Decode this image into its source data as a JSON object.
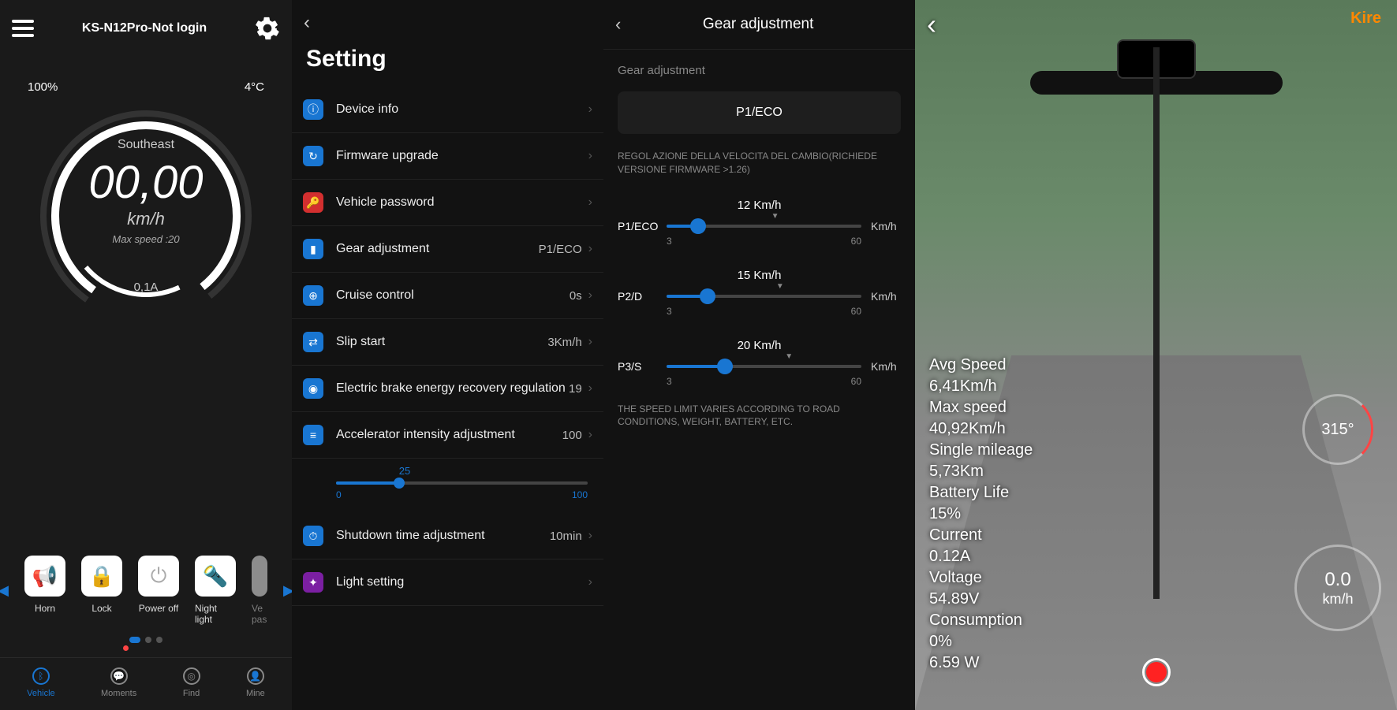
{
  "pane1": {
    "title": "KS-N12Pro-Not login",
    "battery": "100%",
    "temp": "4°C",
    "direction": "Southeast",
    "speed": "00,00",
    "unit": "km/h",
    "maxspeed": "Max speed :20",
    "amps": "0,1A",
    "controls": [
      {
        "label": "Horn",
        "icon": "📢"
      },
      {
        "label": "Lock",
        "icon": "🔒"
      },
      {
        "label": "Power off",
        "icon": "⏻"
      },
      {
        "label": "Night light",
        "icon": "🔦"
      },
      {
        "label": "Ve pas",
        "icon": ""
      }
    ],
    "nav": [
      {
        "label": "Vehicle",
        "active": true
      },
      {
        "label": "Moments",
        "active": false
      },
      {
        "label": "Find",
        "active": false
      },
      {
        "label": "Mine",
        "active": false
      }
    ]
  },
  "pane2": {
    "title": "Setting",
    "items": [
      {
        "label": "Device info",
        "value": "",
        "icon": "ⓘ",
        "color": "blue"
      },
      {
        "label": "Firmware upgrade",
        "value": "",
        "icon": "↻",
        "color": "blue"
      },
      {
        "label": "Vehicle password",
        "value": "",
        "icon": "🔑",
        "color": "red"
      },
      {
        "label": "Gear adjustment",
        "value": "P1/ECO",
        "icon": "▮",
        "color": "blue"
      },
      {
        "label": "Cruise control",
        "value": "0s",
        "icon": "⊕",
        "color": "blue"
      },
      {
        "label": "Slip start",
        "value": "3Km/h",
        "icon": "⇄",
        "color": "blue"
      },
      {
        "label": "Electric brake energy recovery regulation",
        "value": "19",
        "icon": "◉",
        "color": "blue"
      },
      {
        "label": "Accelerator intensity adjustment",
        "value": "100",
        "icon": "≡",
        "color": "blue",
        "slider": {
          "val": "25",
          "min": "0",
          "max": "100",
          "pct": 25
        }
      },
      {
        "label": "Shutdown time adjustment",
        "value": "10min",
        "icon": "⏱",
        "color": "blue"
      },
      {
        "label": "Light setting",
        "value": "",
        "icon": "✦",
        "color": "purple"
      }
    ]
  },
  "pane3": {
    "title": "Gear adjustment",
    "section": "Gear adjustment",
    "mode": "P1/ECO",
    "note1": "REGOL AZIONE DELLA VELOCITA DEL CAMBIO(RICHIEDE VERSIONE FIRMWARE >1.26)",
    "sliders": [
      {
        "label": "P1/ECO",
        "value": "12 Km/h",
        "min": "3",
        "max": "60",
        "unit": "Km/h",
        "pct": 16
      },
      {
        "label": "P2/D",
        "value": "15 Km/h",
        "min": "3",
        "max": "60",
        "unit": "Km/h",
        "pct": 21
      },
      {
        "label": "P3/S",
        "value": "20 Km/h",
        "min": "3",
        "max": "60",
        "unit": "Km/h",
        "pct": 30
      }
    ],
    "note2": "THE SPEED LIMIT VARIES ACCORDING TO ROAD CONDITIONS, WEIGHT, BATTERY, ETC."
  },
  "pane4": {
    "logo": "Kire",
    "compass": "315°",
    "speed_val": "0.0",
    "speed_unit": "km/h",
    "stats": [
      "Avg Speed",
      "6,41Km/h",
      "Max speed",
      "40,92Km/h",
      "Single mileage",
      "5,73Km",
      "Battery Life",
      "15%",
      "Current",
      "0.12A",
      "Voltage",
      "54.89V",
      "Consumption",
      "0%",
      "6.59 W"
    ]
  }
}
